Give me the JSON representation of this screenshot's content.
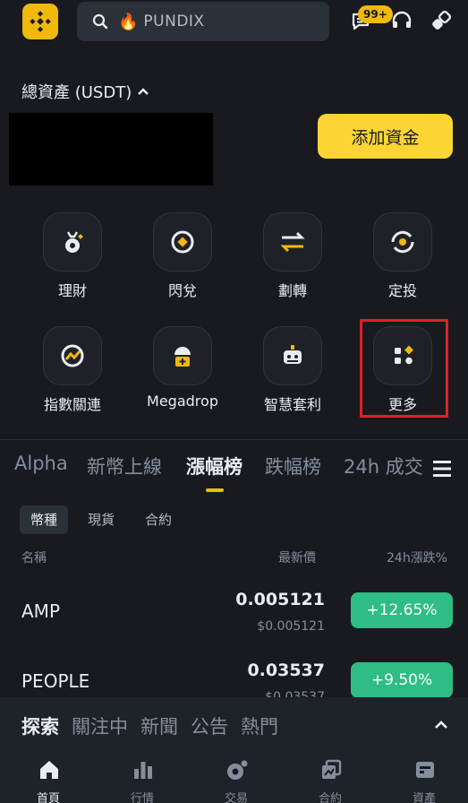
{
  "header": {
    "search_placeholder": "PUNDIX",
    "badge": "99+",
    "icons": [
      "binance-logo-icon",
      "search-icon",
      "fire-icon",
      "chat-icon",
      "headset-icon",
      "link-icon"
    ]
  },
  "assets": {
    "label": "總資產 (USDT)",
    "deposit_label": "添加資金"
  },
  "shortcuts": [
    {
      "label": "理財",
      "icon": "earn-icon"
    },
    {
      "label": "閃兌",
      "icon": "convert-icon"
    },
    {
      "label": "劃轉",
      "icon": "transfer-icon"
    },
    {
      "label": "定投",
      "icon": "auto-invest-icon"
    },
    {
      "label": "指數關連",
      "icon": "index-linked-icon"
    },
    {
      "label": "Megadrop",
      "icon": "megadrop-icon"
    },
    {
      "label": "智慧套利",
      "icon": "arbitrage-bot-icon"
    },
    {
      "label": "更多",
      "icon": "more-icon"
    }
  ],
  "market_tabs": [
    "Alpha",
    "新幣上線",
    "漲幅榜",
    "跌幅榜",
    "24h 成交"
  ],
  "sub_tabs": [
    "幣種",
    "現貨",
    "合約"
  ],
  "columns": {
    "name": "名稱",
    "price": "最新價",
    "change": "24h漲跌%"
  },
  "rows": [
    {
      "symbol": "AMP",
      "price": "0.005121",
      "fiat": "$0.005121",
      "change": "+12.65%"
    },
    {
      "symbol": "PEOPLE",
      "price": "0.03537",
      "fiat": "$0.03537",
      "change": "+9.50%"
    }
  ],
  "explore_tabs": [
    "探索",
    "關注中",
    "新聞",
    "公告",
    "熱門"
  ],
  "bottom_nav": [
    {
      "label": "首頁",
      "icon": "home-icon"
    },
    {
      "label": "行情",
      "icon": "markets-icon"
    },
    {
      "label": "交易",
      "icon": "trade-icon"
    },
    {
      "label": "合約",
      "icon": "futures-icon"
    },
    {
      "label": "資產",
      "icon": "wallet-icon"
    }
  ],
  "colors": {
    "accent": "#f0b90b",
    "background": "#181a20",
    "positive": "#2ebd85",
    "highlight": "#e02127"
  }
}
